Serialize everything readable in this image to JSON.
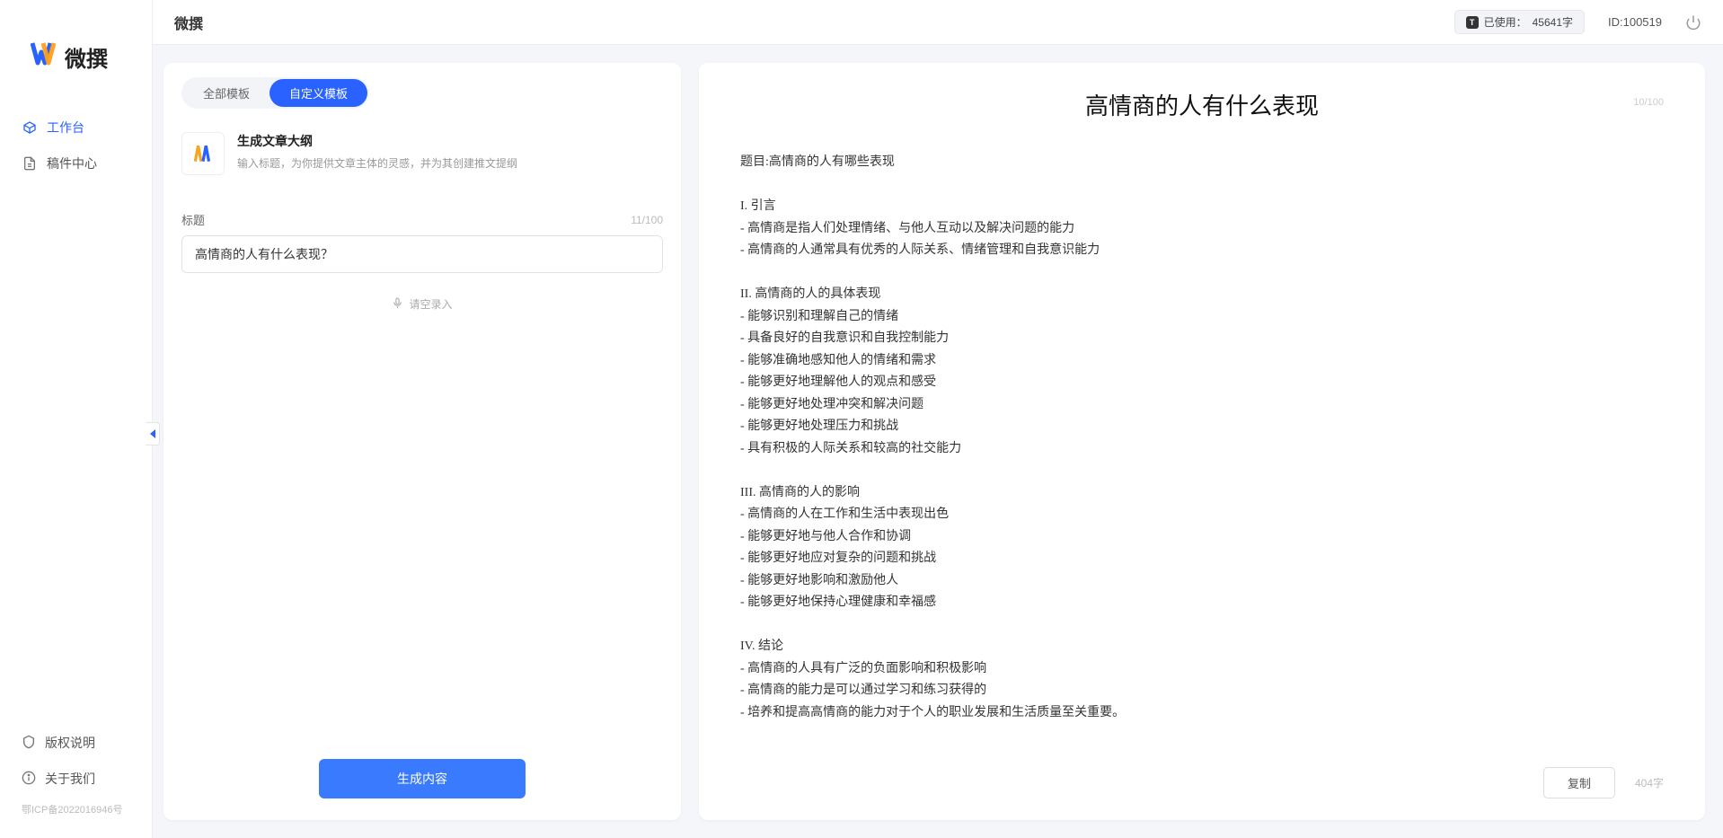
{
  "brand": {
    "name": "微撰"
  },
  "sidebar": {
    "nav": [
      {
        "label": "工作台",
        "active": true
      },
      {
        "label": "稿件中心",
        "active": false
      }
    ],
    "bottom": [
      {
        "label": "版权说明"
      },
      {
        "label": "关于我们"
      }
    ],
    "icp": "鄂ICP备2022016946号"
  },
  "topbar": {
    "title": "微撰",
    "usage_prefix": "已使用：",
    "usage_value": "45641字",
    "id_label": "ID:100519"
  },
  "left": {
    "tabs": [
      {
        "label": "全部模板",
        "active": false
      },
      {
        "label": "自定义模板",
        "active": true
      }
    ],
    "template": {
      "title": "生成文章大纲",
      "desc": "输入标题，为你提供文章主体的灵感，并为其创建推文提纲"
    },
    "field_label": "标题",
    "char_count": "11/100",
    "input_value": "高情商的人有什么表现？",
    "voice_label": "请空录入",
    "gen_button": "生成内容"
  },
  "right": {
    "title": "高情商的人有什么表现",
    "title_count": "10/100",
    "body": "题目:高情商的人有哪些表现\n\nI. 引言\n- 高情商是指人们处理情绪、与他人互动以及解决问题的能力\n- 高情商的人通常具有优秀的人际关系、情绪管理和自我意识能力\n\nII. 高情商的人的具体表现\n- 能够识别和理解自己的情绪\n- 具备良好的自我意识和自我控制能力\n- 能够准确地感知他人的情绪和需求\n- 能够更好地理解他人的观点和感受\n- 能够更好地处理冲突和解决问题\n- 能够更好地处理压力和挑战\n- 具有积极的人际关系和较高的社交能力\n\nIII. 高情商的人的影响\n- 高情商的人在工作和生活中表现出色\n- 能够更好地与他人合作和协调\n- 能够更好地应对复杂的问题和挑战\n- 能够更好地影响和激励他人\n- 能够更好地保持心理健康和幸福感\n\nIV. 结论\n- 高情商的人具有广泛的负面影响和积极影响\n- 高情商的能力是可以通过学习和练习获得的\n- 培养和提高高情商的能力对于个人的职业发展和生活质量至关重要。",
    "copy_button": "复制",
    "word_count": "404字"
  }
}
